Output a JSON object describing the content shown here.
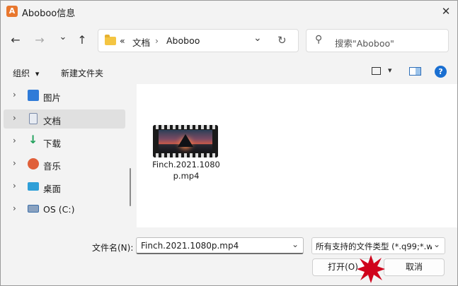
{
  "window": {
    "app_icon_glyph": "A",
    "title": "Aboboo信息",
    "close_glyph": "✕"
  },
  "nav": {
    "back_glyph": "←",
    "forward_glyph": "→",
    "recent_glyph": "⌄",
    "up_glyph": "↑"
  },
  "address": {
    "overflow": "«",
    "crumbs": [
      "文档",
      "Aboboo"
    ],
    "sep": "›",
    "dropdown_glyph": "⌄",
    "refresh_glyph": "↻"
  },
  "search": {
    "icon_glyph": "⚲",
    "placeholder": "搜索\"Aboboo\""
  },
  "command_bar": {
    "organize": "组织",
    "organize_arrow": "▾",
    "new_folder": "新建文件夹",
    "view_arrow": "▾",
    "help": "?"
  },
  "sidebar": {
    "items": [
      {
        "label": "图片",
        "icon": "pictures-icon",
        "color": "#2f7bd8"
      },
      {
        "label": "文档",
        "icon": "documents-icon",
        "color": "#7a8aa8",
        "selected": true
      },
      {
        "label": "下载",
        "icon": "downloads-icon",
        "color": "#1fa05a"
      },
      {
        "label": "音乐",
        "icon": "music-icon",
        "color": "#e0603a"
      },
      {
        "label": "桌面",
        "icon": "desktop-icon",
        "color": "#2f9fd8"
      },
      {
        "label": "OS (C:)",
        "icon": "drive-icon",
        "color": "#3c6ea8"
      }
    ],
    "chevron": "›"
  },
  "files": [
    {
      "name": "Finch.2021.1080p.mp4",
      "icon": "video-thumbnail"
    }
  ],
  "footer": {
    "filename_label": "文件名(N):",
    "filename_value": "Finch.2021.1080p.mp4",
    "filetype_value": "所有支持的文件类型 (*.q99;*.w",
    "open_button": "打开(O)",
    "cancel_button": "取消",
    "open_dropdown_glyph": "▾"
  },
  "colors": {
    "accent": "#0067c0",
    "burst": "#d0021b"
  }
}
